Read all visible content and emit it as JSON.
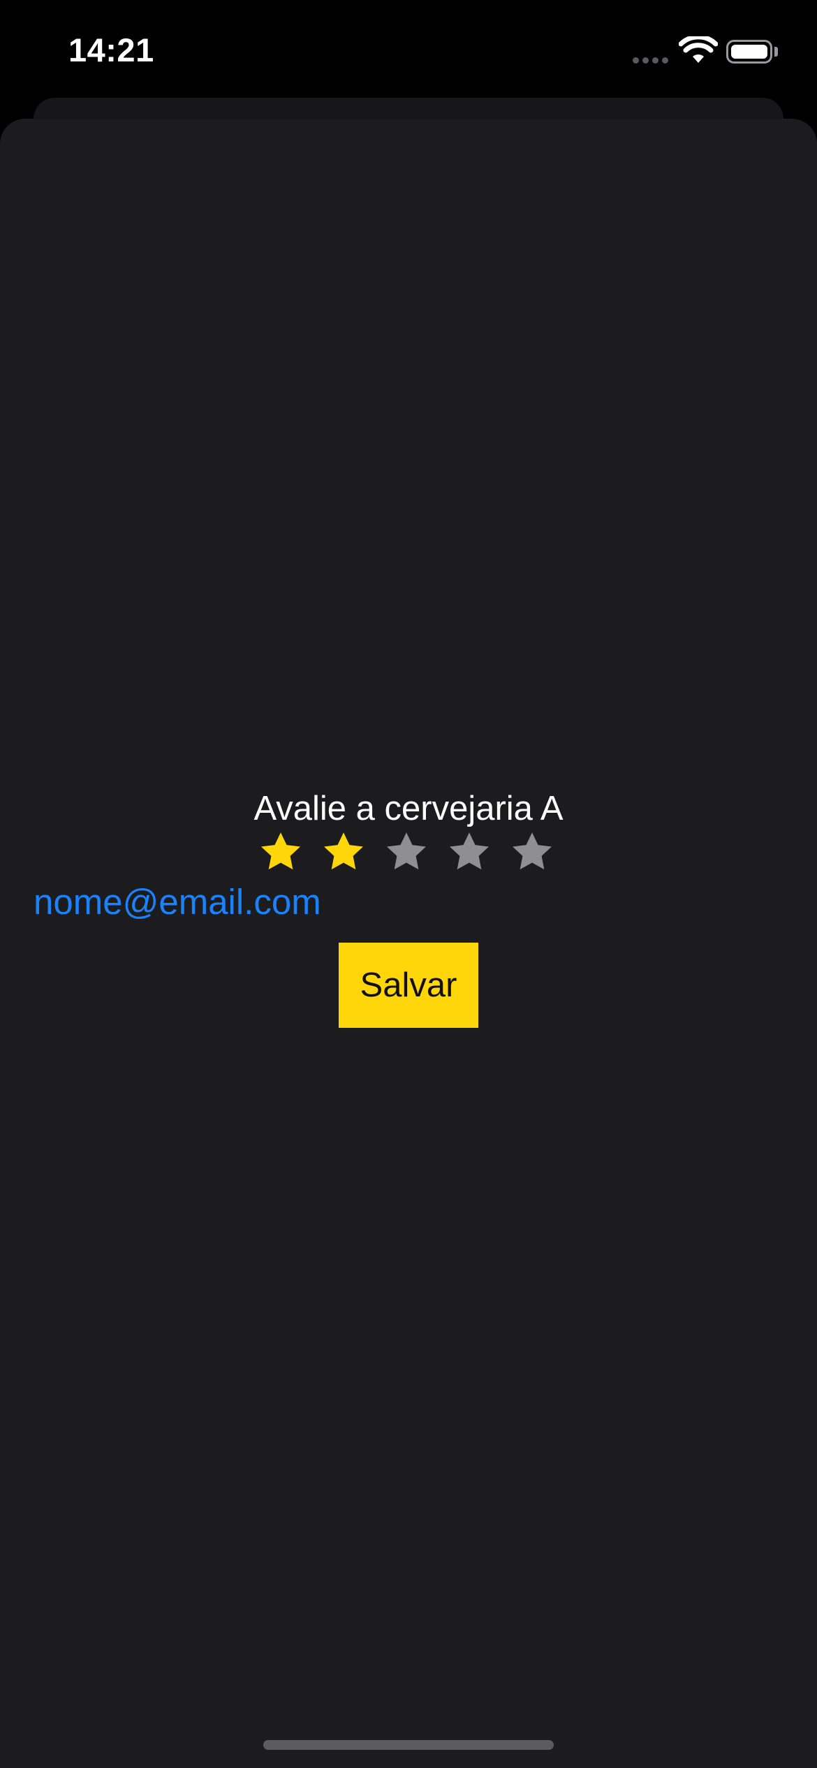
{
  "status_bar": {
    "time": "14:21",
    "signal_icon": "cellular-signal-dots",
    "wifi_icon": "wifi-icon",
    "battery_icon": "battery-full-icon"
  },
  "rating": {
    "title": "Avalie a cervejaria A",
    "value": 2,
    "max": 5,
    "filled_color": "#ffd60a",
    "empty_color": "#8e8e93",
    "star_icon": "star-icon"
  },
  "email": {
    "text": "nome@email.com",
    "color": "#1a82fb"
  },
  "save_button": {
    "label": "Salvar",
    "color": "#ffd60a"
  },
  "colors": {
    "background": "#000000",
    "sheet": "#1c1c1e"
  }
}
